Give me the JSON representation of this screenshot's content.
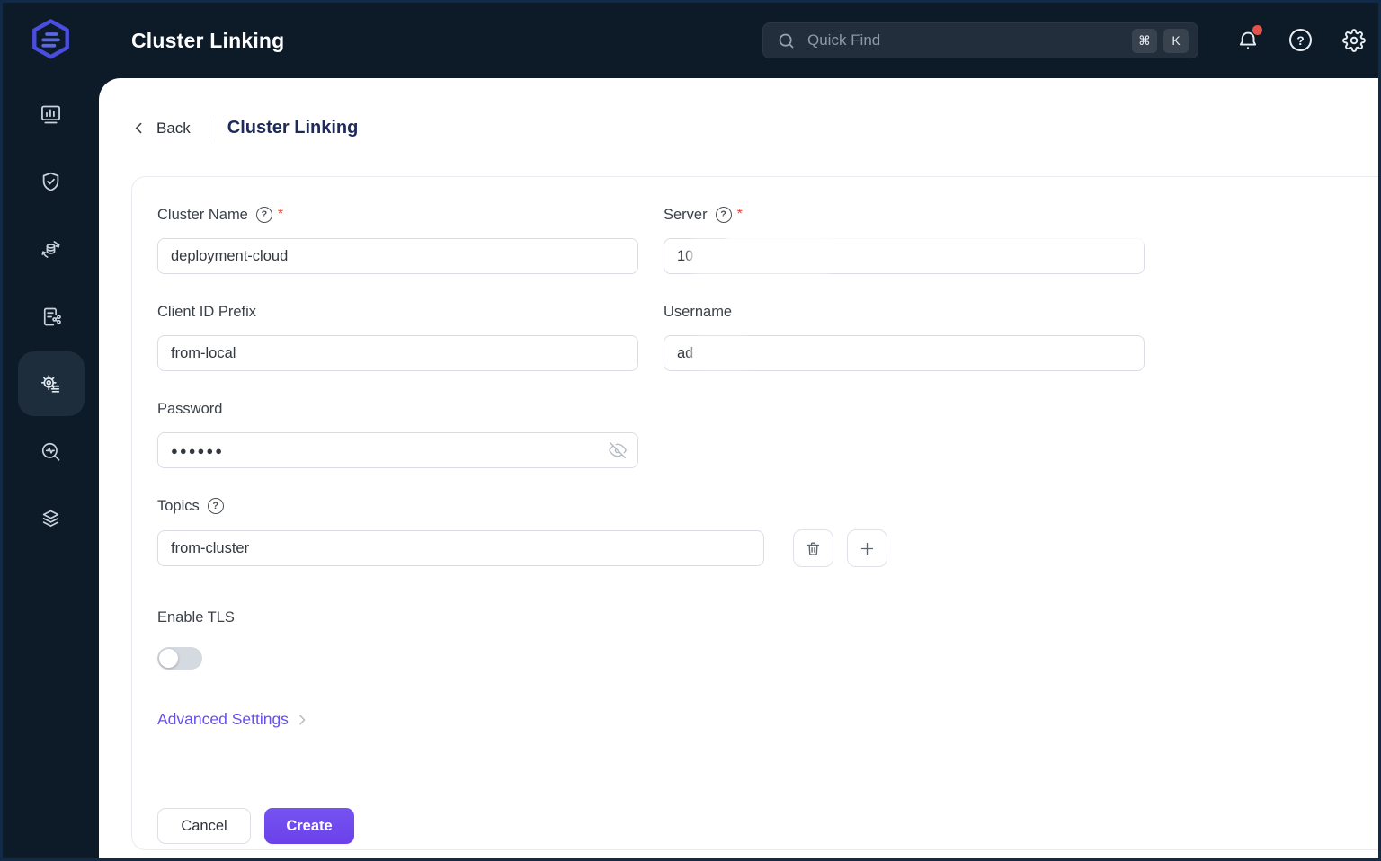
{
  "window": {
    "frame_color": "#112a47"
  },
  "header": {
    "bg_color": "#0d1b29",
    "title": "Cluster Linking",
    "logo_icon": "emqx-hexagon-logo",
    "search": {
      "placeholder": "Quick Find",
      "shortcut_cmd": "⌘",
      "shortcut_key": "K",
      "icon": "search-icon"
    },
    "help_glyph": "?",
    "notification_dot_color": "#e25449"
  },
  "sidebar": {
    "active_index": 4,
    "items": [
      {
        "icon": "dashboard-chart-icon",
        "active": false
      },
      {
        "icon": "shield-check-icon",
        "active": false
      },
      {
        "icon": "data-sync-icon",
        "active": false
      },
      {
        "icon": "server-share-icon",
        "active": false
      },
      {
        "icon": "gear-config-icon",
        "active": true
      },
      {
        "icon": "diagnose-magnifier-icon",
        "active": false
      },
      {
        "icon": "layers-icon",
        "active": false
      }
    ]
  },
  "breadcrumb": {
    "back_label": "Back",
    "page_title": "Cluster Linking"
  },
  "form": {
    "required_marker": "*",
    "help_glyph": "?",
    "cluster_name": {
      "label": "Cluster Name",
      "value": "deployment-cloud",
      "required": true
    },
    "server": {
      "label": "Server",
      "value": "10",
      "required": true,
      "redacted": true
    },
    "client_id_prefix": {
      "label": "Client ID Prefix",
      "value": "from-local"
    },
    "username": {
      "label": "Username",
      "value": "ad",
      "redacted": true
    },
    "password": {
      "label": "Password",
      "value": "●●●●●●",
      "masked": true
    },
    "topics": {
      "label": "Topics",
      "values": [
        "from-cluster"
      ]
    },
    "enable_tls": {
      "label": "Enable TLS",
      "enabled": false
    },
    "advanced_settings_label": "Advanced Settings"
  },
  "actions": {
    "cancel_label": "Cancel",
    "create_label": "Create",
    "create_color": "#6b41ea"
  }
}
